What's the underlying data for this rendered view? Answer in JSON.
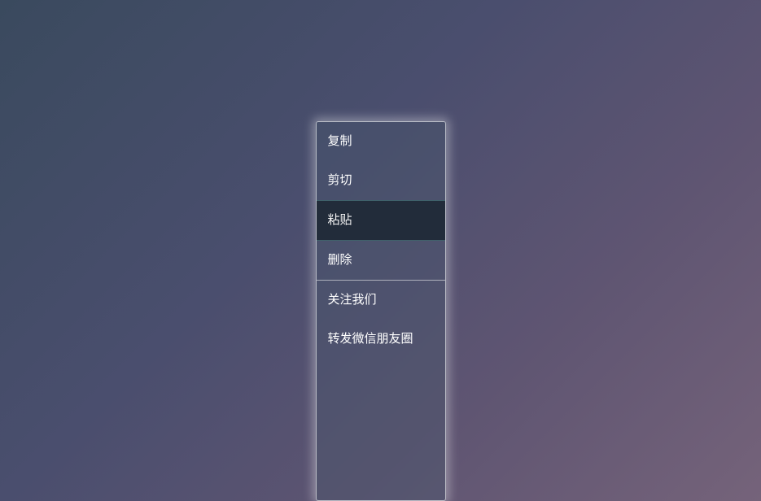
{
  "menu": {
    "groups": [
      {
        "items": [
          {
            "id": "copy",
            "label": "复制",
            "active": false
          },
          {
            "id": "cut",
            "label": "剪切",
            "active": false
          },
          {
            "id": "paste",
            "label": "粘贴",
            "active": true
          },
          {
            "id": "delete",
            "label": "删除",
            "active": false
          }
        ]
      },
      {
        "items": [
          {
            "id": "follow-us",
            "label": "关注我们",
            "active": false
          },
          {
            "id": "share-wechat",
            "label": "转发微信朋友圈",
            "active": false
          }
        ]
      }
    ]
  }
}
